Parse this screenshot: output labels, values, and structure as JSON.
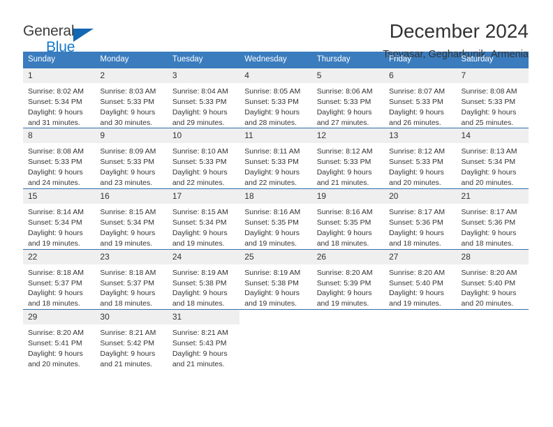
{
  "logo": {
    "primary": "General",
    "secondary": "Blue",
    "triangle_color": "#1268b3",
    "secondary_color": "#1577c9"
  },
  "header": {
    "title": "December 2024",
    "subtitle": "Tsovasar, Gegharkunik, Armenia"
  },
  "theme": {
    "header_blue": "#3a7cbe",
    "separator_blue": "#2f6fae",
    "daynum_band": "#efefef",
    "text": "#333333"
  },
  "weekdays": [
    "Sunday",
    "Monday",
    "Tuesday",
    "Wednesday",
    "Thursday",
    "Friday",
    "Saturday"
  ],
  "weeks": [
    {
      "days": [
        {
          "num": "1",
          "sunrise": "Sunrise: 8:02 AM",
          "sunset": "Sunset: 5:34 PM",
          "daylight1": "Daylight: 9 hours",
          "daylight2": "and 31 minutes."
        },
        {
          "num": "2",
          "sunrise": "Sunrise: 8:03 AM",
          "sunset": "Sunset: 5:33 PM",
          "daylight1": "Daylight: 9 hours",
          "daylight2": "and 30 minutes."
        },
        {
          "num": "3",
          "sunrise": "Sunrise: 8:04 AM",
          "sunset": "Sunset: 5:33 PM",
          "daylight1": "Daylight: 9 hours",
          "daylight2": "and 29 minutes."
        },
        {
          "num": "4",
          "sunrise": "Sunrise: 8:05 AM",
          "sunset": "Sunset: 5:33 PM",
          "daylight1": "Daylight: 9 hours",
          "daylight2": "and 28 minutes."
        },
        {
          "num": "5",
          "sunrise": "Sunrise: 8:06 AM",
          "sunset": "Sunset: 5:33 PM",
          "daylight1": "Daylight: 9 hours",
          "daylight2": "and 27 minutes."
        },
        {
          "num": "6",
          "sunrise": "Sunrise: 8:07 AM",
          "sunset": "Sunset: 5:33 PM",
          "daylight1": "Daylight: 9 hours",
          "daylight2": "and 26 minutes."
        },
        {
          "num": "7",
          "sunrise": "Sunrise: 8:08 AM",
          "sunset": "Sunset: 5:33 PM",
          "daylight1": "Daylight: 9 hours",
          "daylight2": "and 25 minutes."
        }
      ]
    },
    {
      "days": [
        {
          "num": "8",
          "sunrise": "Sunrise: 8:08 AM",
          "sunset": "Sunset: 5:33 PM",
          "daylight1": "Daylight: 9 hours",
          "daylight2": "and 24 minutes."
        },
        {
          "num": "9",
          "sunrise": "Sunrise: 8:09 AM",
          "sunset": "Sunset: 5:33 PM",
          "daylight1": "Daylight: 9 hours",
          "daylight2": "and 23 minutes."
        },
        {
          "num": "10",
          "sunrise": "Sunrise: 8:10 AM",
          "sunset": "Sunset: 5:33 PM",
          "daylight1": "Daylight: 9 hours",
          "daylight2": "and 22 minutes."
        },
        {
          "num": "11",
          "sunrise": "Sunrise: 8:11 AM",
          "sunset": "Sunset: 5:33 PM",
          "daylight1": "Daylight: 9 hours",
          "daylight2": "and 22 minutes."
        },
        {
          "num": "12",
          "sunrise": "Sunrise: 8:12 AM",
          "sunset": "Sunset: 5:33 PM",
          "daylight1": "Daylight: 9 hours",
          "daylight2": "and 21 minutes."
        },
        {
          "num": "13",
          "sunrise": "Sunrise: 8:12 AM",
          "sunset": "Sunset: 5:33 PM",
          "daylight1": "Daylight: 9 hours",
          "daylight2": "and 20 minutes."
        },
        {
          "num": "14",
          "sunrise": "Sunrise: 8:13 AM",
          "sunset": "Sunset: 5:34 PM",
          "daylight1": "Daylight: 9 hours",
          "daylight2": "and 20 minutes."
        }
      ]
    },
    {
      "days": [
        {
          "num": "15",
          "sunrise": "Sunrise: 8:14 AM",
          "sunset": "Sunset: 5:34 PM",
          "daylight1": "Daylight: 9 hours",
          "daylight2": "and 19 minutes."
        },
        {
          "num": "16",
          "sunrise": "Sunrise: 8:15 AM",
          "sunset": "Sunset: 5:34 PM",
          "daylight1": "Daylight: 9 hours",
          "daylight2": "and 19 minutes."
        },
        {
          "num": "17",
          "sunrise": "Sunrise: 8:15 AM",
          "sunset": "Sunset: 5:34 PM",
          "daylight1": "Daylight: 9 hours",
          "daylight2": "and 19 minutes."
        },
        {
          "num": "18",
          "sunrise": "Sunrise: 8:16 AM",
          "sunset": "Sunset: 5:35 PM",
          "daylight1": "Daylight: 9 hours",
          "daylight2": "and 19 minutes."
        },
        {
          "num": "19",
          "sunrise": "Sunrise: 8:16 AM",
          "sunset": "Sunset: 5:35 PM",
          "daylight1": "Daylight: 9 hours",
          "daylight2": "and 18 minutes."
        },
        {
          "num": "20",
          "sunrise": "Sunrise: 8:17 AM",
          "sunset": "Sunset: 5:36 PM",
          "daylight1": "Daylight: 9 hours",
          "daylight2": "and 18 minutes."
        },
        {
          "num": "21",
          "sunrise": "Sunrise: 8:17 AM",
          "sunset": "Sunset: 5:36 PM",
          "daylight1": "Daylight: 9 hours",
          "daylight2": "and 18 minutes."
        }
      ]
    },
    {
      "days": [
        {
          "num": "22",
          "sunrise": "Sunrise: 8:18 AM",
          "sunset": "Sunset: 5:37 PM",
          "daylight1": "Daylight: 9 hours",
          "daylight2": "and 18 minutes."
        },
        {
          "num": "23",
          "sunrise": "Sunrise: 8:18 AM",
          "sunset": "Sunset: 5:37 PM",
          "daylight1": "Daylight: 9 hours",
          "daylight2": "and 18 minutes."
        },
        {
          "num": "24",
          "sunrise": "Sunrise: 8:19 AM",
          "sunset": "Sunset: 5:38 PM",
          "daylight1": "Daylight: 9 hours",
          "daylight2": "and 18 minutes."
        },
        {
          "num": "25",
          "sunrise": "Sunrise: 8:19 AM",
          "sunset": "Sunset: 5:38 PM",
          "daylight1": "Daylight: 9 hours",
          "daylight2": "and 19 minutes."
        },
        {
          "num": "26",
          "sunrise": "Sunrise: 8:20 AM",
          "sunset": "Sunset: 5:39 PM",
          "daylight1": "Daylight: 9 hours",
          "daylight2": "and 19 minutes."
        },
        {
          "num": "27",
          "sunrise": "Sunrise: 8:20 AM",
          "sunset": "Sunset: 5:40 PM",
          "daylight1": "Daylight: 9 hours",
          "daylight2": "and 19 minutes."
        },
        {
          "num": "28",
          "sunrise": "Sunrise: 8:20 AM",
          "sunset": "Sunset: 5:40 PM",
          "daylight1": "Daylight: 9 hours",
          "daylight2": "and 20 minutes."
        }
      ]
    },
    {
      "days": [
        {
          "num": "29",
          "sunrise": "Sunrise: 8:20 AM",
          "sunset": "Sunset: 5:41 PM",
          "daylight1": "Daylight: 9 hours",
          "daylight2": "and 20 minutes."
        },
        {
          "num": "30",
          "sunrise": "Sunrise: 8:21 AM",
          "sunset": "Sunset: 5:42 PM",
          "daylight1": "Daylight: 9 hours",
          "daylight2": "and 21 minutes."
        },
        {
          "num": "31",
          "sunrise": "Sunrise: 8:21 AM",
          "sunset": "Sunset: 5:43 PM",
          "daylight1": "Daylight: 9 hours",
          "daylight2": "and 21 minutes."
        },
        {
          "num": "",
          "sunrise": "",
          "sunset": "",
          "daylight1": "",
          "daylight2": ""
        },
        {
          "num": "",
          "sunrise": "",
          "sunset": "",
          "daylight1": "",
          "daylight2": ""
        },
        {
          "num": "",
          "sunrise": "",
          "sunset": "",
          "daylight1": "",
          "daylight2": ""
        },
        {
          "num": "",
          "sunrise": "",
          "sunset": "",
          "daylight1": "",
          "daylight2": ""
        }
      ]
    }
  ]
}
